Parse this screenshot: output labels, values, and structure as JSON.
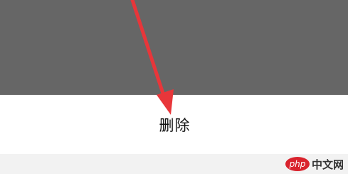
{
  "action_sheet": {
    "delete_label": "删除"
  },
  "watermark": {
    "logo_text": "php",
    "site_text": "中文网"
  },
  "annotation": {
    "icon": "red-arrow-icon",
    "color": "#e8363a"
  },
  "colors": {
    "overlay": "#666666",
    "sheet": "#ffffff",
    "bottom_bar": "#f2f2f2",
    "watermark_logo": "#d9232d"
  }
}
